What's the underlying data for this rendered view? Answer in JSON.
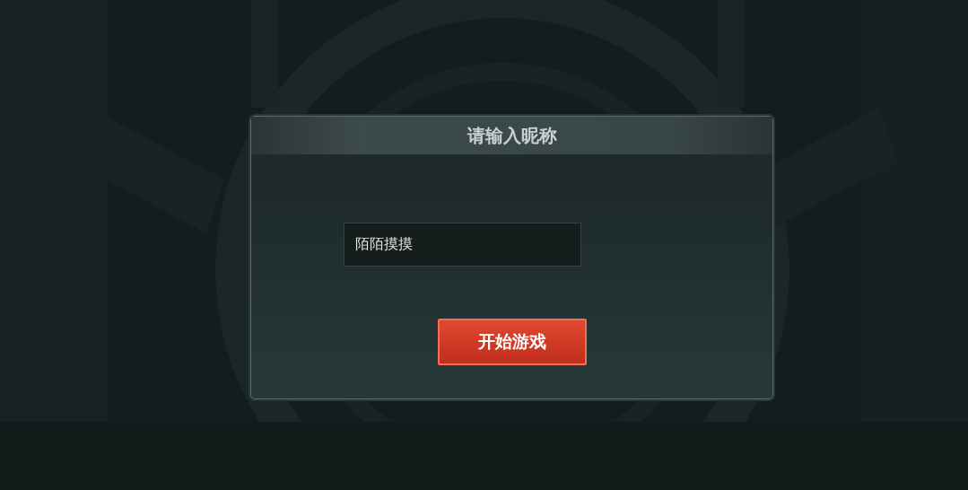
{
  "dialog": {
    "title": "请输入昵称",
    "nickname_field": {
      "value": "陌陌摸摸"
    },
    "start_button": {
      "label": "开始游戏"
    }
  }
}
